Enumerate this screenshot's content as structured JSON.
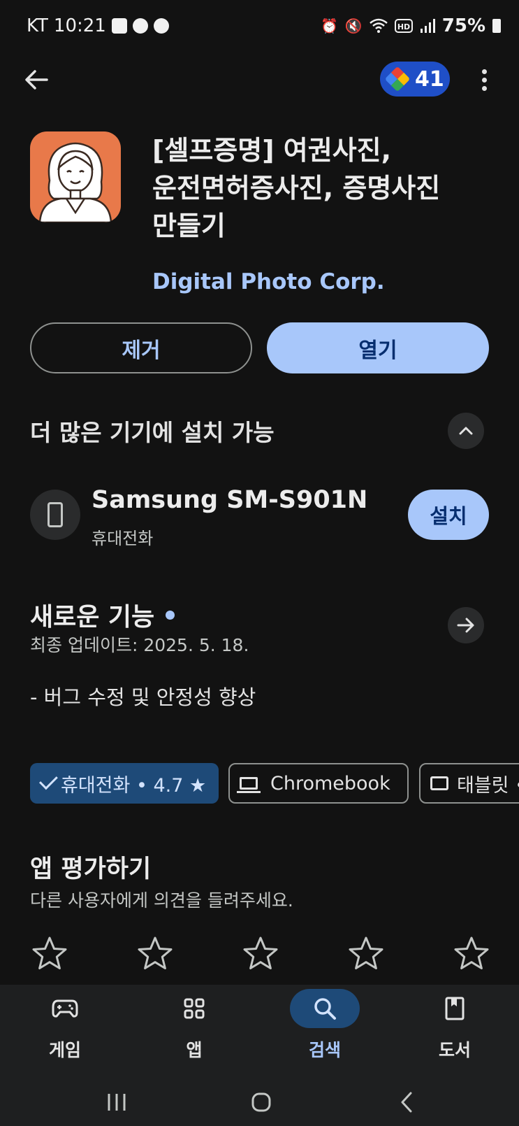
{
  "status_bar": {
    "carrier": "KT",
    "time": "10:21",
    "battery": "75%"
  },
  "top_bar": {
    "points": "41"
  },
  "app": {
    "title_line1": "[셀프증명] 여권사진,",
    "title_line2": "운전면허증사진, 증명사진",
    "title_line3": "만들기",
    "developer": "Digital Photo Corp."
  },
  "actions": {
    "uninstall_label": "제거",
    "open_label": "열기"
  },
  "devices": {
    "heading": "더 많은 기기에 설치 가능",
    "device_name": "Samsung SM-S901N",
    "device_type": "휴대전화",
    "install_label": "설치"
  },
  "whats_new": {
    "heading": "새로운 기능",
    "updated": "최종 업데이트: 2025. 5. 18.",
    "notes": "- 버그 수정 및 안정성 향상"
  },
  "device_chips": [
    {
      "label": "휴대전화 • 4.7 ★",
      "selected": true,
      "icon": "check-icon"
    },
    {
      "label": "Chromebook",
      "selected": false,
      "icon": "laptop-icon"
    },
    {
      "label": "태블릿 •",
      "selected": false,
      "icon": "tablet-icon"
    }
  ],
  "rate": {
    "heading": "앱 평가하기",
    "subtitle": "다른 사용자에게 의견을 들려주세요.",
    "star_count": 5,
    "rating": 0
  },
  "bottom_nav": [
    {
      "label": "게임",
      "icon": "gamepad-icon",
      "active": false
    },
    {
      "label": "앱",
      "icon": "apps-grid-icon",
      "active": false
    },
    {
      "label": "검색",
      "icon": "search-icon",
      "active": true
    },
    {
      "label": "도서",
      "icon": "book-icon",
      "active": false
    }
  ],
  "colors": {
    "background": "#121212",
    "accent": "#a8c7fa",
    "accent_dark_text": "#062e6f",
    "app_icon_bg": "#e8794a",
    "selected_chip": "#1e4a78",
    "points_chip": "#1f4fc7"
  }
}
